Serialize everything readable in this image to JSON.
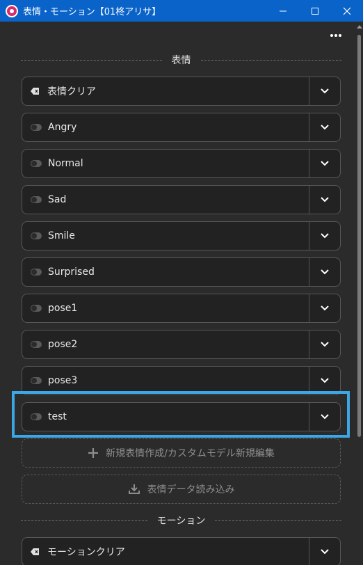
{
  "window": {
    "title": "表情・モーション【01柊アリサ】",
    "minimize_icon": "minimize-icon",
    "maximize_icon": "maximize-icon",
    "close_icon": "close-icon"
  },
  "toolbar": {
    "more_icon": "more-dots-icon"
  },
  "expressions": {
    "header": "表情",
    "clear_label": "表情クリア",
    "items": [
      {
        "label": "Angry"
      },
      {
        "label": "Normal"
      },
      {
        "label": "Sad"
      },
      {
        "label": "Smile"
      },
      {
        "label": "Surprised"
      },
      {
        "label": "pose1"
      },
      {
        "label": "pose2"
      },
      {
        "label": "pose3"
      },
      {
        "label": "test"
      }
    ],
    "new_button": "新規表情作成/カスタムモデル新規編集",
    "import_button": "表情データ読み込み"
  },
  "motions": {
    "header": "モーション",
    "clear_label": "モーションクリア"
  },
  "colors": {
    "titlebar": "#0a63c9",
    "highlight": "#3ca7e6",
    "item_bg": "#222222",
    "panel_bg": "#2b2b2b"
  }
}
